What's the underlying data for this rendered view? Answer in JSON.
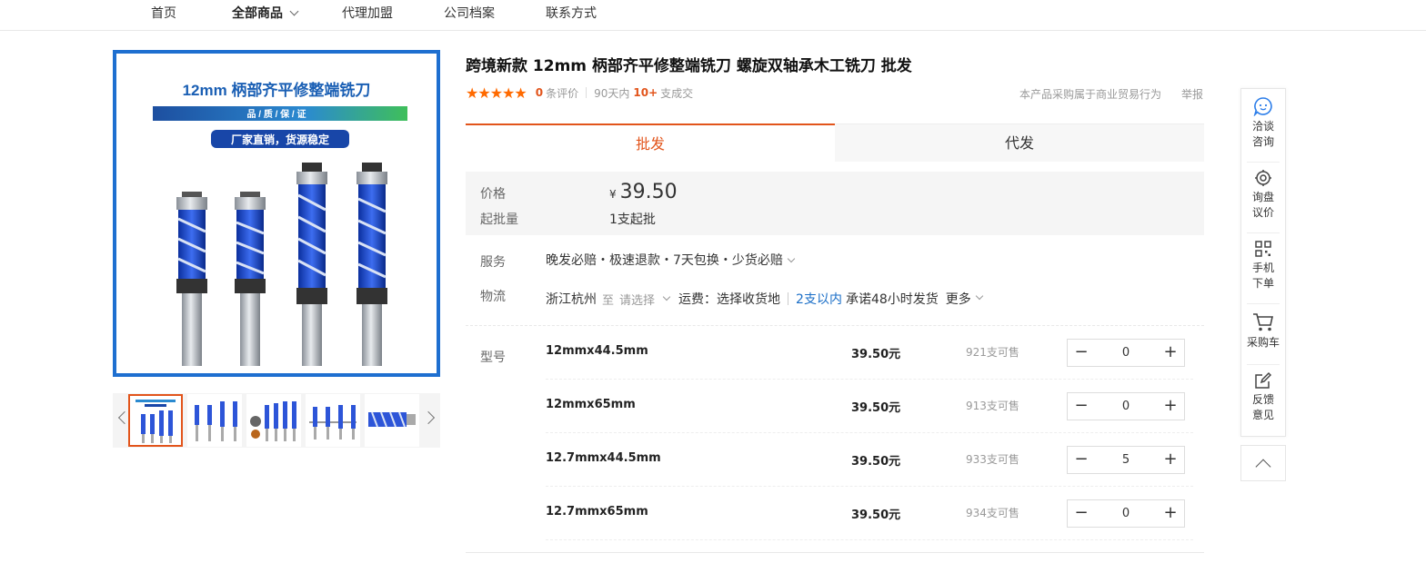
{
  "nav": {
    "items": [
      "首页",
      "全部商品",
      "代理加盟",
      "公司档案",
      "联系方式"
    ]
  },
  "product_image": {
    "banner_title": "12mm 柄部齐平修整端铣刀",
    "quality_band": "品 / 质 / 保 / 证",
    "factory_tag": "厂家直销，货源稳定"
  },
  "product": {
    "title": "跨境新款 12mm 柄部齐平修整端铣刀 螺旋双轴承木工铣刀 批发",
    "stars": "★★★★★",
    "review_count": "0",
    "review_label": "条评价",
    "period": "90天内",
    "sold_count": "10+",
    "sold_label": "支成交",
    "trade_note": "本产品采购属于商业贸易行为",
    "report": "举报"
  },
  "tabs": [
    "批发",
    "代发"
  ],
  "price": {
    "label": "价格",
    "currency": "¥",
    "value": "39.50",
    "moq_label": "起批量",
    "moq_value": "1支起批"
  },
  "service": {
    "label": "服务",
    "text": "晚发必赔・极速退款・7天包换・少货必赔"
  },
  "logistics": {
    "label": "物流",
    "from": "浙江杭州",
    "to_word": "至",
    "select_placeholder": "请选择",
    "fee": "运费：选择收货地",
    "qty_note": "2支以内",
    "promise": "承诺48小时发货",
    "more": "更多"
  },
  "sku": {
    "label": "型号",
    "rows": [
      {
        "name": "12mmx44.5mm",
        "price": "39.50元",
        "stock": "921支可售",
        "qty": "0"
      },
      {
        "name": "12mmx65mm",
        "price": "39.50元",
        "stock": "913支可售",
        "qty": "0"
      },
      {
        "name": "12.7mmx44.5mm",
        "price": "39.50元",
        "stock": "933支可售",
        "qty": "5"
      },
      {
        "name": "12.7mmx65mm",
        "price": "39.50元",
        "stock": "934支可售",
        "qty": "0"
      }
    ],
    "minus": "−",
    "plus": "+"
  },
  "float_panel": {
    "items": [
      "洽谈\n咨询",
      "询盘\n议价",
      "手机\n下单",
      "采购车",
      "反馈\n意见"
    ]
  },
  "colors": {
    "accent": "#e2541b",
    "star": "#ff6a00",
    "link": "#1a6ec7",
    "tool_blue": "#1e6fd0"
  }
}
